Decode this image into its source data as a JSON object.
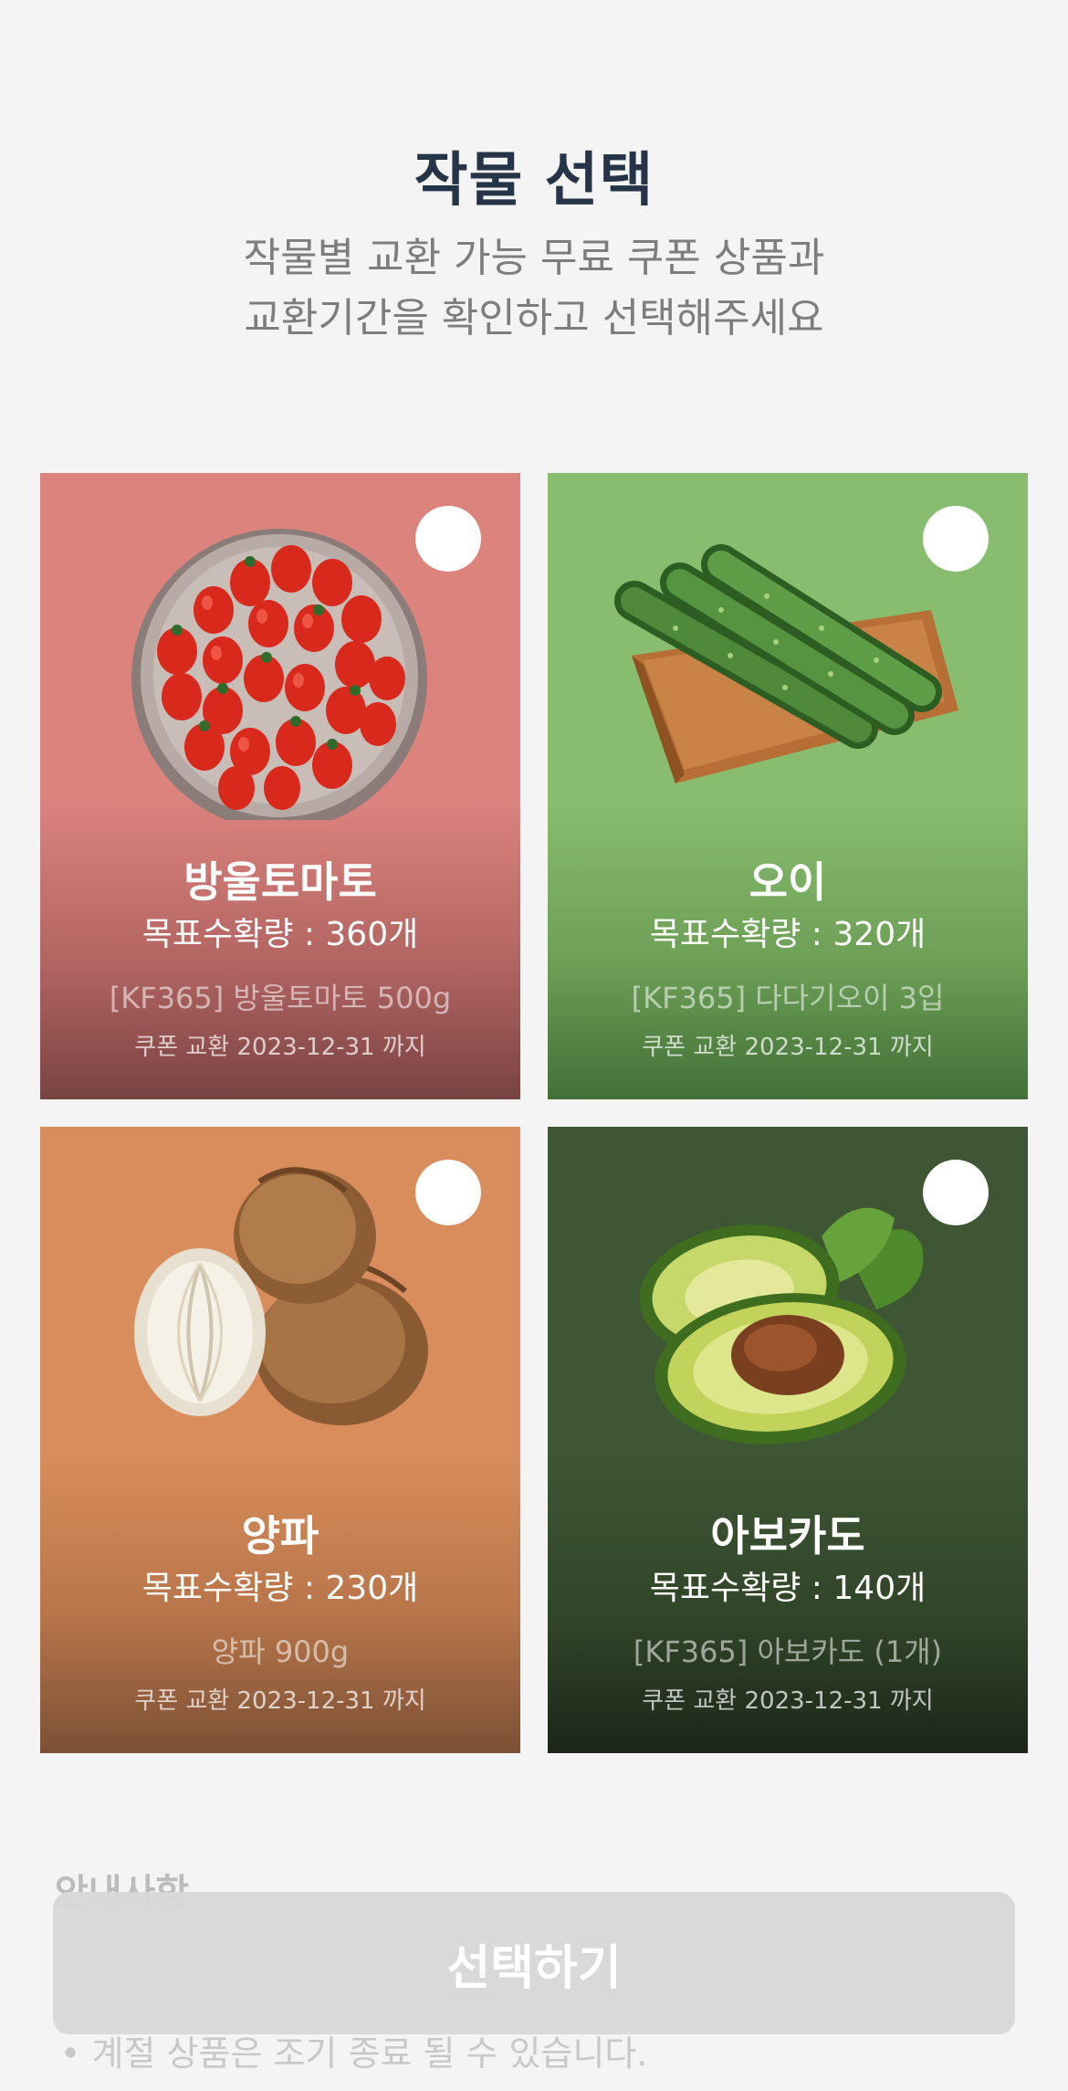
{
  "header": {
    "title": "작물 선택",
    "subtitle_line1": "작물별 교환 가능 무료 쿠폰 상품과",
    "subtitle_line2": "교환기간을 확인하고 선택해주세요"
  },
  "crops": [
    {
      "name": "방울토마토",
      "goal": "목표수확량 : 360개",
      "product": "[KF365] 방울토마토 500g",
      "period": "쿠폰 교환 2023-12-31 까지",
      "bg_color": "#dc837e",
      "image": "cherry-tomato-bowl"
    },
    {
      "name": "오이",
      "goal": "목표수확량 : 320개",
      "product": "[KF365] 다다기오이 3입",
      "period": "쿠폰 교환 2023-12-31 까지",
      "bg_color": "#88bc6e",
      "image": "cucumber-tray"
    },
    {
      "name": "양파",
      "goal": "목표수확량 : 230개",
      "product": "양파 900g",
      "period": "쿠폰 교환 2023-12-31 까지",
      "bg_color": "#d98d5c",
      "image": "onions"
    },
    {
      "name": "아보카도",
      "goal": "목표수확량 : 140개",
      "product": "[KF365] 아보카도 (1개)",
      "period": "쿠폰 교환 2023-12-31 까지",
      "bg_color": "#3e5634",
      "image": "avocado"
    }
  ],
  "notice": {
    "heading": "안내사항",
    "item": "•  계절 상품은 조기 종료 될 수 있습니다."
  },
  "select_button_label": "선택하기",
  "colors": {
    "background": "#f4f4f4",
    "title": "#263447",
    "subtitle": "#7d7d7d",
    "button_disabled": "#d8d8d8"
  }
}
